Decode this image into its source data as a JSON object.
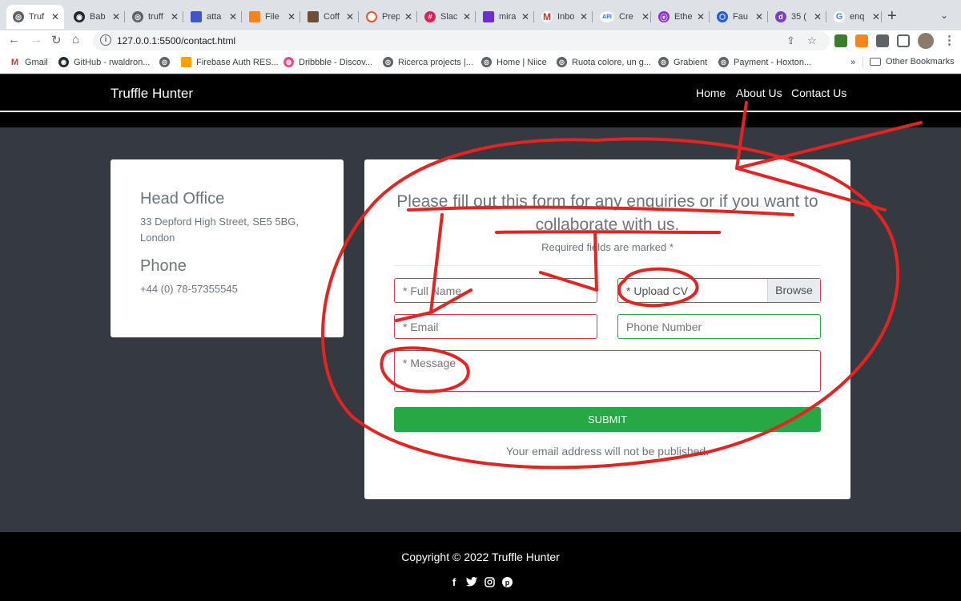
{
  "browser": {
    "tabs": [
      {
        "label": "Truf",
        "icon": "globe-icon",
        "color": "#5f6368",
        "active": true
      },
      {
        "label": "Bab",
        "icon": "github-icon",
        "color": "#24292e"
      },
      {
        "label": "truff",
        "icon": "globe-icon",
        "color": "#5f6368"
      },
      {
        "label": "atta",
        "icon": "doc-icon",
        "color": "#4355c4"
      },
      {
        "label": "File",
        "icon": "figma-icon",
        "color": "#f58220"
      },
      {
        "label": "Coff",
        "icon": "coffee-icon",
        "color": "#6f4e37"
      },
      {
        "label": "Prep",
        "icon": "ring-icon",
        "color": "#ff4f1f"
      },
      {
        "label": "Slac",
        "icon": "slack-icon",
        "color": "#e01e5a"
      },
      {
        "label": "mira",
        "icon": "mail-icon",
        "color": "#6b2fd1"
      },
      {
        "label": "Inbo",
        "icon": "gmail-icon",
        "color": "#d93025"
      },
      {
        "label": "Cre",
        "icon": "api-icon",
        "color": "#1a73e8"
      },
      {
        "label": "Ethe",
        "icon": "ether-icon",
        "color": "#8a2be2"
      },
      {
        "label": "Fau",
        "icon": "hex-icon",
        "color": "#2a5ada"
      },
      {
        "label": "35 (",
        "icon": "d-icon",
        "color": "#7b3fbf"
      },
      {
        "label": "enq",
        "icon": "google-icon",
        "color": "#4285f4"
      }
    ],
    "url": "127.0.0.1:5500/contact.html",
    "bookmarks": [
      {
        "label": "Gmail",
        "icon": "gmail-icon",
        "color": "#d93025"
      },
      {
        "label": "GitHub - rwaldron...",
        "icon": "github-icon",
        "color": "#24292e"
      },
      {
        "label": "",
        "icon": "globe-icon",
        "color": "#5f6368"
      },
      {
        "label": "Firebase Auth RES...",
        "icon": "firebase-icon",
        "color": "#ffa000"
      },
      {
        "label": "Dribbble - Discov...",
        "icon": "dribbble-icon",
        "color": "#ea4c89"
      },
      {
        "label": "Ricerca projects |...",
        "icon": "globe-icon",
        "color": "#5f6368"
      },
      {
        "label": "Home | Niice",
        "icon": "globe-icon",
        "color": "#5f6368"
      },
      {
        "label": "Ruota colore, un g...",
        "icon": "globe-icon",
        "color": "#5f6368"
      },
      {
        "label": "Grabient",
        "icon": "globe-icon",
        "color": "#5f6368"
      },
      {
        "label": "Payment - Hoxton...",
        "icon": "globe-icon",
        "color": "#5f6368"
      }
    ],
    "bookmarks_more": "»",
    "other_bookmarks": "Other Bookmarks"
  },
  "site": {
    "brand": "Truffle Hunter",
    "nav": [
      "Home",
      "About Us",
      "Contact Us"
    ]
  },
  "office": {
    "heading": "Head Office",
    "address": "33 Depford High Street, SE5 5BG, London",
    "phone_heading": "Phone",
    "phone": "+44 (0) 78-57355545"
  },
  "form": {
    "title": "Please fill out this form for any enquiries or if you want to collaborate with us.",
    "required_note": "Required fields are marked *",
    "name_placeholder": "* Full Name",
    "upload_label": "* Upload CV",
    "browse_label": "Browse",
    "email_placeholder": "* Email",
    "phone_placeholder": "Phone Number",
    "message_placeholder": "* Message",
    "submit_label": "SUBMIT",
    "footnote": "Your email address will not be published."
  },
  "footer": {
    "copyright": "Copyright © 2022 Truffle Hunter",
    "socials": [
      "facebook-icon",
      "twitter-icon",
      "instagram-icon",
      "pinterest-icon"
    ]
  },
  "colors": {
    "accent_green": "#28a745",
    "error_red": "#dc3545",
    "annotation_red": "#e52421",
    "page_dark": "#343a40"
  }
}
